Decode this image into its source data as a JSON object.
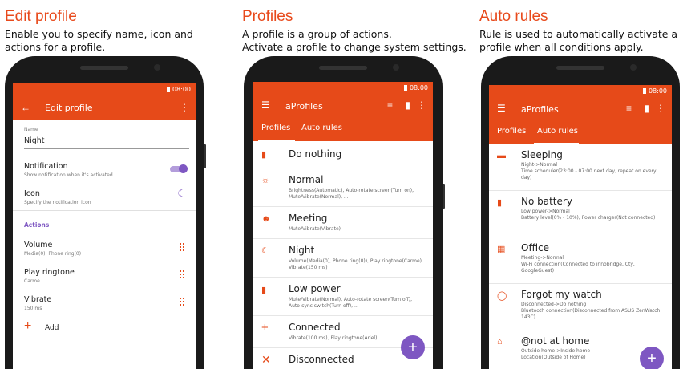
{
  "panels": [
    {
      "caption_title": "Edit profile",
      "caption_text": "Enable you to specify name, icon and\nactions for a profile.",
      "status_time": "08:00",
      "appbar_title": "Edit profile",
      "name_label": "Name",
      "name_value": "Night",
      "notification_title": "Notification",
      "notification_sub": "Show notification when it's activated",
      "icon_title": "Icon",
      "icon_sub": "Specify the notification icon",
      "actions_header": "Actions",
      "actions": [
        {
          "title": "Volume",
          "sub": "Media(0), Phone ring(0)"
        },
        {
          "title": "Play ringtone",
          "sub": "Carme"
        },
        {
          "title": "Vibrate",
          "sub": "150 ms"
        }
      ],
      "add_label": "Add"
    },
    {
      "caption_title": "Profiles",
      "caption_text": "A profile is a group of actions.\nActivate a profile to change system settings.",
      "status_time": "08:00",
      "appbar_title": "aProfiles",
      "tabs": [
        "Profiles",
        "Auto rules"
      ],
      "items": [
        {
          "title": "Do nothing",
          "sub": ""
        },
        {
          "title": "Normal",
          "sub": "Brightness(Automatic), Auto-rotate screen(Turn on), Mute/Vibrate(Normal), ..."
        },
        {
          "title": "Meeting",
          "sub": "Mute/Vibrate(Vibrate)"
        },
        {
          "title": "Night",
          "sub": "Volume(Media(0), Phone ring(0)), Play ringtone(Carme), Vibrate(150 ms)"
        },
        {
          "title": "Low power",
          "sub": "Mute/Vibrate(Normal), Auto-rotate screen(Turn off), Auto-sync switch(Turn off), ..."
        },
        {
          "title": "Connected",
          "sub": "Vibrate(100 ms), Play ringtone(Ariel)"
        },
        {
          "title": "Disconnected",
          "sub": ""
        }
      ]
    },
    {
      "caption_title": "Auto rules",
      "caption_text": "Rule is used to automatically activate a\nprofile when all conditions apply.",
      "status_time": "08:00",
      "appbar_title": "aProfiles",
      "tabs": [
        "Profiles",
        "Auto rules"
      ],
      "items": [
        {
          "title": "Sleeping",
          "sub": "Night->Normal\nTime scheduler(23:00 - 07:00 next day, repeat on every day)"
        },
        {
          "title": "No battery",
          "sub": "Low power->Normal\nBattery level(0% - 10%), Power charger(Not connected)"
        },
        {
          "title": "Office",
          "sub": "Meeting->Normal\nWi-Fi connection(Connected to innobridge, Cty, GoogleGuest)"
        },
        {
          "title": "Forgot my watch",
          "sub": "Disconnected->Do nothing\nBluetooth connection(Disconnected from ASUS ZenWatch 143C)"
        },
        {
          "title": "@not at home",
          "sub": "Outside home->Inside home\nLocation(Outside of Home)"
        }
      ]
    }
  ],
  "icons": {
    "back": "arrow-left-icon",
    "menu": "hamburger-menu-icon",
    "more": "more-vert-icon"
  },
  "colors": {
    "accent": "#e84a1c",
    "appbar": "#e64a19",
    "fab": "#7e57c2"
  }
}
